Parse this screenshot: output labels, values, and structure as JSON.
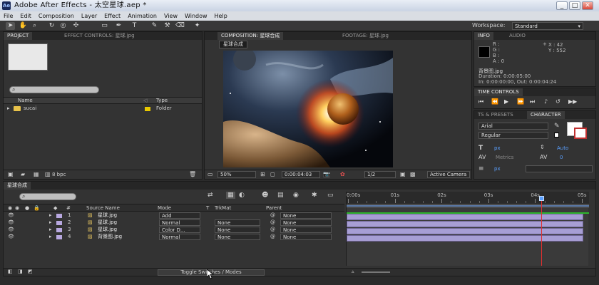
{
  "window": {
    "title": "Adobe After Effects - 太空星球.aep *",
    "app_icon": "Ae",
    "min": "_",
    "max": "□",
    "close": "✕"
  },
  "menu": [
    "File",
    "Edit",
    "Composition",
    "Layer",
    "Effect",
    "Animation",
    "View",
    "Window",
    "Help"
  ],
  "tools": [
    "select",
    "hand",
    "zoom",
    "rotate",
    "camera",
    "pan-behind",
    "rect-mask",
    "pen",
    "text",
    "brush",
    "clone",
    "eraser",
    "puppet"
  ],
  "workspace": {
    "label": "Workspace:",
    "value": "Standard"
  },
  "project_panel": {
    "tabs": [
      "PROJECT",
      "EFFECT CONTROLS: 星球.jpg"
    ],
    "columns": {
      "name": "Name",
      "type": "Type"
    },
    "items": [
      {
        "name": "sucai",
        "type": "Folder"
      }
    ],
    "bpc": "8 bpc"
  },
  "comp_panel": {
    "tabs": [
      "COMPOSITION: 星球合成",
      "FOOTAGE: 星球.jpg"
    ],
    "comp_tab": "星球合成",
    "zoom": "50%",
    "timecode": "0:00:04:03",
    "resolution": "1/2",
    "camera": "Active Camera"
  },
  "info_panel": {
    "tabs": [
      "INFO",
      "AUDIO"
    ],
    "r": "R :",
    "g": "G :",
    "b": "B :",
    "a": "A : 0",
    "x": "X : 42",
    "y": "Y : 552",
    "file": "背景图.jpg",
    "duration": "Duration: 0:00:05:00",
    "inout": "In: 0:00:00:00, Out: 0:00:04:24"
  },
  "time_controls": {
    "tab": "TIME CONTROLS"
  },
  "character_panel": {
    "tabs": [
      "TS & PRESETS",
      "CHARACTER"
    ],
    "font": "Arial",
    "style": "Regular",
    "size_unit": "px",
    "leading": "Auto",
    "kerning": "Metrics",
    "tracking": "0",
    "stroke_unit": "px"
  },
  "timeline": {
    "tab": "星球合成",
    "columns": {
      "num": "#",
      "source": "Source Name",
      "mode": "Mode",
      "t": "T",
      "trkmat": "TrkMat",
      "parent": "Parent"
    },
    "layers": [
      {
        "num": "1",
        "name": "星球.jpg",
        "mode": "Add",
        "trkmat": "",
        "parent": "None",
        "color": "#b8a8e0"
      },
      {
        "num": "2",
        "name": "星球.jpg",
        "mode": "Normal",
        "trkmat": "None",
        "parent": "None",
        "color": "#b8a8e0"
      },
      {
        "num": "3",
        "name": "星球.jpg",
        "mode": "Color D...",
        "trkmat": "None",
        "parent": "None",
        "color": "#b8a8e0"
      },
      {
        "num": "4",
        "name": "背景图.jpg",
        "mode": "Normal",
        "trkmat": "None",
        "parent": "None",
        "color": "#b8a8e0"
      }
    ],
    "ruler": [
      "0:00s",
      "01s",
      "02s",
      "03s",
      "04s",
      "05s"
    ],
    "playhead_seconds": 4.13,
    "duration_seconds": 5,
    "toggle_label": "Toggle Switches / Modes"
  }
}
